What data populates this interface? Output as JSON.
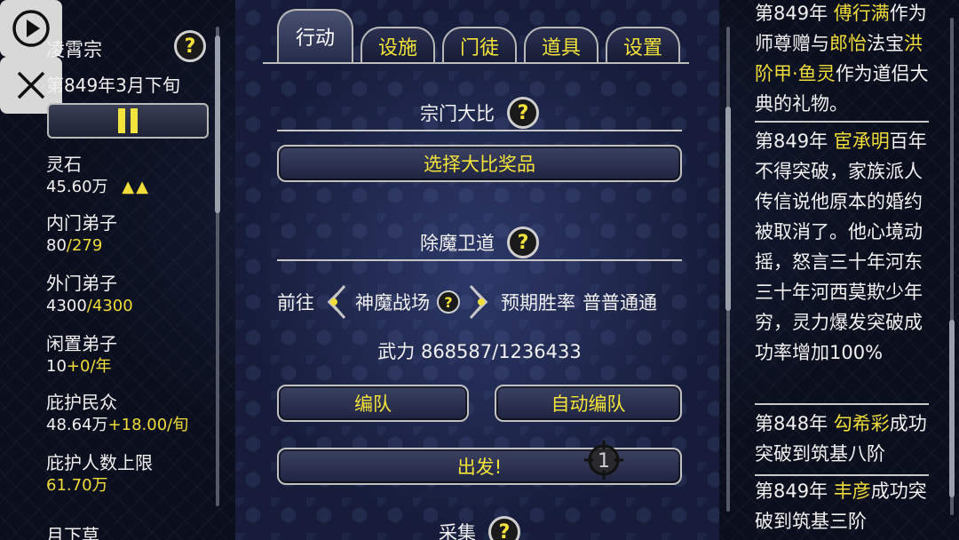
{
  "left": {
    "sect_name": "凌霄宗",
    "date": "第849年3月下旬",
    "stats": [
      {
        "label": "灵石",
        "value": "45.60万",
        "extra": "▲▲"
      },
      {
        "label": "内门弟子",
        "value_a": "80",
        "value_b": "/279"
      },
      {
        "label": "外门弟子",
        "value_a": "4300",
        "value_b": "/4300"
      },
      {
        "label": "闲置弟子",
        "value_a": "10",
        "value_b": "+0/年"
      },
      {
        "label": "庇护民众",
        "value_a": "48.64万",
        "value_b": "+18.00/旬"
      },
      {
        "label": "庇护人数上限",
        "value": "61.70万"
      },
      {
        "label": "月下草"
      }
    ]
  },
  "tabs": [
    "行动",
    "设施",
    "门徒",
    "道具",
    "设置"
  ],
  "center": {
    "section1": {
      "title": "宗门大比",
      "button": "选择大比奖品"
    },
    "section2": {
      "title": "除魔卫道",
      "go_label": "前往",
      "destination": "神魔战场",
      "expect_label": "预期胜率",
      "expect_value": "普普通通",
      "power_label": "武力",
      "power_value": "868587/1236433",
      "team_button": "编队",
      "auto_team_button": "自动编队",
      "start_button": "出发!",
      "marker_number": "1"
    },
    "section3": {
      "title": "采集"
    }
  },
  "log": [
    {
      "year": "第849年",
      "name": "傅行满",
      "t1": "作为师尊赠与",
      "name2": "郎怡",
      "t2": "法宝",
      "item": "洪阶甲·鱼灵",
      "t3": "作为道侣大典的礼物。"
    },
    {
      "year": "第849年",
      "name": "宦承明",
      "t1": "百年不得突破，家族派人传信说他原本的婚约被取消了。他心境动摇，怒言三十年河东三十年河西莫欺少年穷，灵力爆发突破成功率增加100%"
    },
    {
      "year": "第848年",
      "name": "勾希彩",
      "t1": "成功突破到筑基八阶"
    },
    {
      "year": "第849年",
      "name": "丰彦",
      "t1": "成功突破到筑基三阶"
    }
  ],
  "colors": {
    "accent": "#f0dc3a",
    "frame": "#c0c0c0",
    "panel": "#1e2340"
  }
}
